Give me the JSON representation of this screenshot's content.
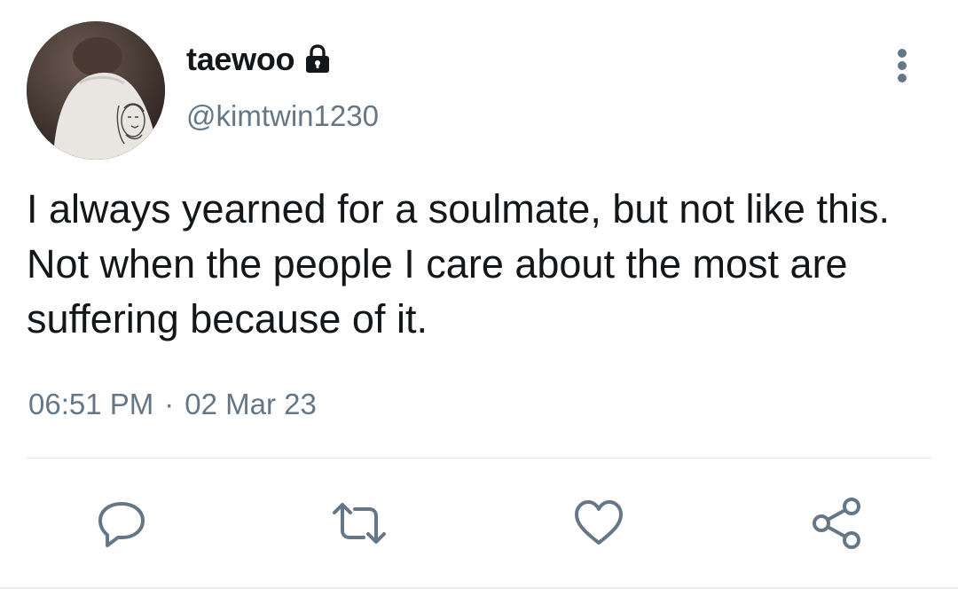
{
  "user": {
    "display_name": "taewoo",
    "handle": "@kimtwin1230",
    "protected_icon": "lock-icon",
    "avatar_icon": "avatar"
  },
  "tweet": {
    "text": "I always yearned for a soulmate, but not like this. Not when the people I care about the most are suffering because of it.",
    "time": "06:51 PM",
    "separator": "·",
    "date": "02 Mar 23"
  },
  "menu": {
    "icon": "more-vertical-icon"
  },
  "actions": [
    {
      "name": "reply",
      "icon": "reply-icon"
    },
    {
      "name": "retweet",
      "icon": "retweet-icon"
    },
    {
      "name": "like",
      "icon": "heart-icon"
    },
    {
      "name": "share",
      "icon": "share-icon"
    }
  ],
  "colors": {
    "text_primary": "#14171a",
    "text_secondary": "#657786",
    "icon": "#657786",
    "divider": "#e1e8ed"
  }
}
